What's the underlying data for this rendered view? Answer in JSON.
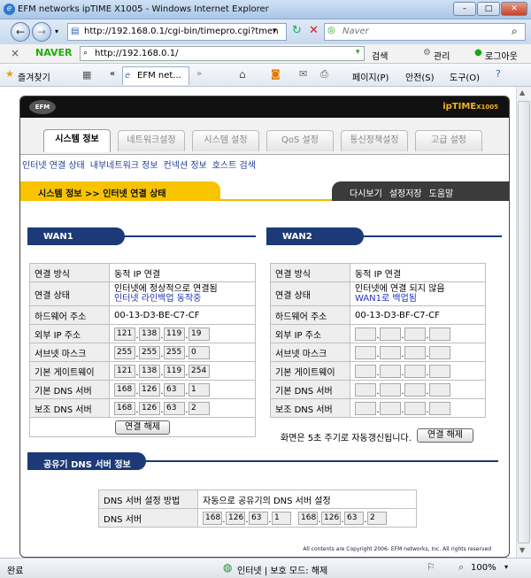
{
  "window": {
    "title": "EFM networks ipTIME X1005 - Windows Internet Explorer",
    "minimize": "–",
    "maximize": "□",
    "close": "✕"
  },
  "browser": {
    "url": "http://192.168.0.1/cgi-bin/timepro.cgi?tmen",
    "search_placeholder": "Naver",
    "naver_label": "NAVER",
    "naver_url": "http://192.168.0.1/",
    "naver_menu": [
      "검색",
      "관리",
      "로그아웃"
    ],
    "favorites_label": "즐겨찾기",
    "tab_label": "EFM net...",
    "toolbar_menu": [
      "페이지(P)",
      "안전(S)",
      "도구(O)"
    ]
  },
  "router": {
    "brand": "ipTIME",
    "brand_model": "X1005",
    "logo": "EFM",
    "tabs": [
      "시스템 정보",
      "네트워크설정",
      "시스템 설정",
      "QoS 설정",
      "통신정책설정",
      "고급 설정"
    ],
    "subnav": [
      "인터넷 연결 상태",
      "내부네트워크 정보",
      "컨넥션 정보",
      "호스트 검색"
    ],
    "breadcrumb": "시스템 정보 >> 인터넷 연결 상태",
    "actions": [
      "다시보기",
      "설정저장",
      "도움말"
    ]
  },
  "labels": {
    "conn_method": "연결 방식",
    "conn_status": "연결 상태",
    "mac": "하드웨어 주소",
    "ext_ip": "외부 IP 주소",
    "subnet": "서브넷 마스크",
    "gateway": "기본 게이트웨이",
    "dns1": "기본 DNS 서버",
    "dns2": "보조 DNS 서버"
  },
  "wan1": {
    "title": "WAN1",
    "method": "동적 IP 연결",
    "status_line1": "인터넷에 정상적으로 연결됨",
    "status_line2": "인터넷 라인백업 동작중",
    "mac": "00-13-D3-BE-C7-CF",
    "ip": [
      "121",
      "138",
      "119",
      "19"
    ],
    "subnet": [
      "255",
      "255",
      "255",
      "0"
    ],
    "gateway": [
      "121",
      "138",
      "119",
      "254"
    ],
    "dns1": [
      "168",
      "126",
      "63",
      "1"
    ],
    "dns2": [
      "168",
      "126",
      "63",
      "2"
    ],
    "button": "연결 해제"
  },
  "wan2": {
    "title": "WAN2",
    "method": "동적 IP 연결",
    "status_line1": "인터넷에 연결 되지 않음",
    "status_line2": "WAN1로 백업됨",
    "mac": "00-13-D3-BF-C7-CF",
    "refresh_note": "화면은 5초 주기로 자동갱신됩니다.",
    "button": "연결 해제"
  },
  "dns_section": {
    "title": "공유기 DNS 서버 정보",
    "method_label": "DNS 서버 설정 방법",
    "method_value": "자동으로 공유기의 DNS 서버 설정",
    "server_label": "DNS 서버",
    "server1": [
      "168",
      "126",
      "63",
      "1"
    ],
    "server2": [
      "168",
      "126",
      "63",
      "2"
    ]
  },
  "footer": "All contents are Copyright   2006- EFM networks, Inc. All rights reserved",
  "status": {
    "left": "완료",
    "zone": "인터넷 | 보호 모드: 해제",
    "zoom": "100%"
  }
}
